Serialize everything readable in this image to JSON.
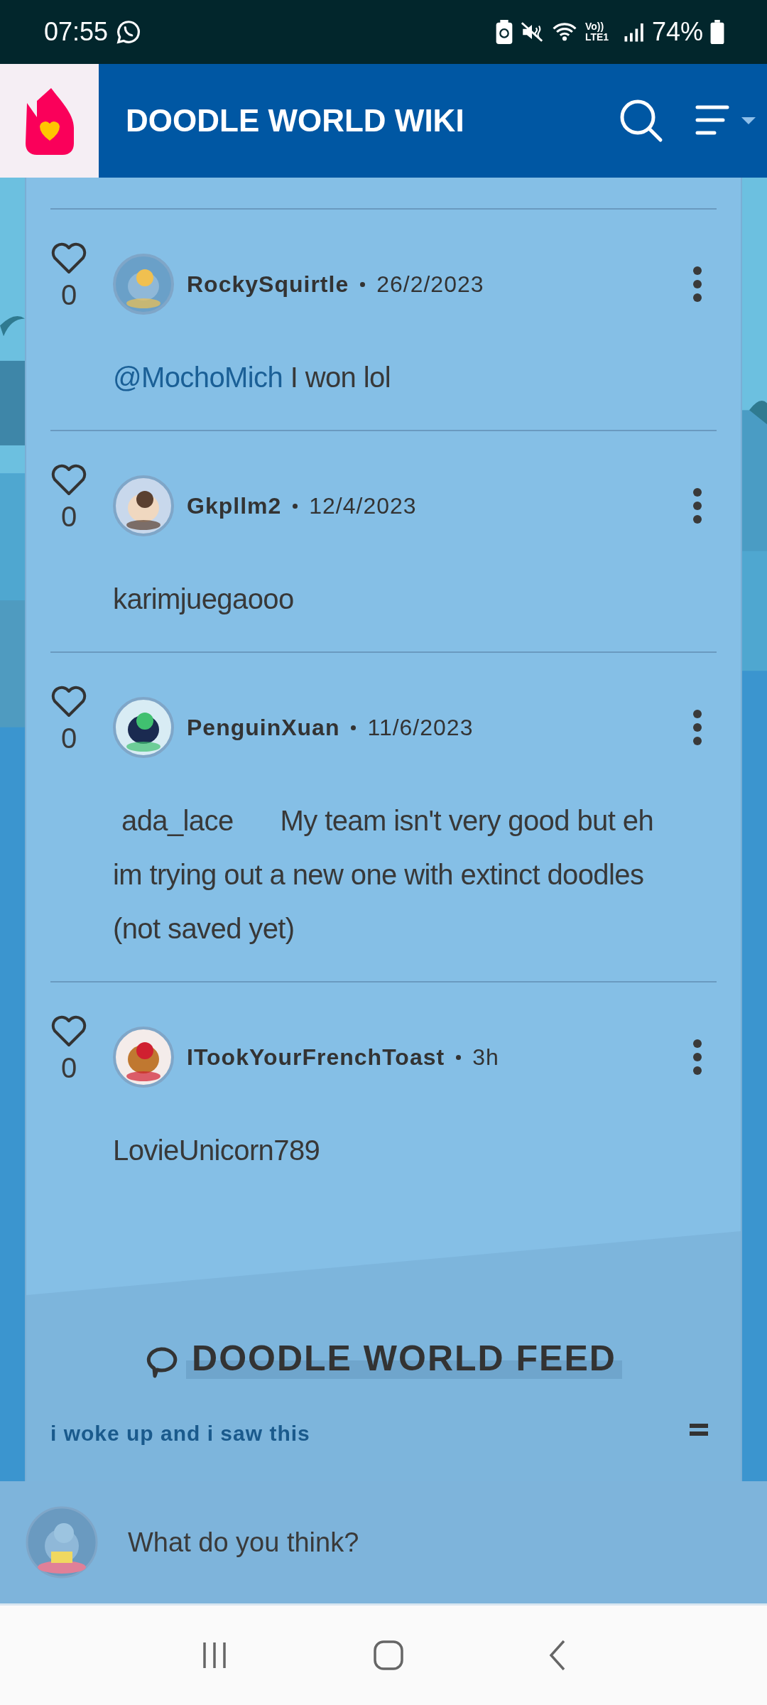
{
  "status_bar": {
    "time": "07:55",
    "battery": "74%",
    "network": "Vo)) LTE1"
  },
  "header": {
    "title": "DOODLE WORLD WIKI"
  },
  "comments": [
    {
      "likes": "0",
      "user": "RockySquirtle",
      "date": "26/2/2023",
      "mention": "@MochoMich",
      "text": "I won lol"
    },
    {
      "likes": "0",
      "user": "Gkpllm2",
      "date": "12/4/2023",
      "text": "karimjuegaooo"
    },
    {
      "likes": "0",
      "user": "PenguinXuan",
      "date": "11/6/2023",
      "lead": "ada_lace",
      "text": "My team isn't very good but eh im trying out a new one with extinct doodles (not saved yet)"
    },
    {
      "likes": "0",
      "user": "ITookYourFrenchToast",
      "date": "3h",
      "text": "LovieUnicorn789"
    }
  ],
  "feed": {
    "title": "DOODLE WORLD FEED",
    "first_post": "i woke up and i saw this"
  },
  "reply_bar": {
    "placeholder": "What do you think?"
  }
}
